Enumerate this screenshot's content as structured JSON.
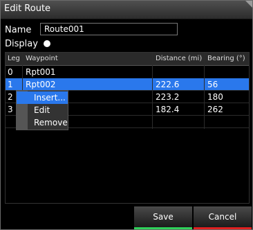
{
  "dialog": {
    "title": "Edit Route"
  },
  "form": {
    "name_label": "Name",
    "name_value": "Route001",
    "display_label": "Display"
  },
  "table": {
    "headers": [
      "Leg",
      "Waypoint",
      "Distance (mi)",
      "Bearing (°)"
    ],
    "rows": [
      {
        "leg": "0",
        "waypoint": "Rpt001",
        "distance": "",
        "bearing": ""
      },
      {
        "leg": "1",
        "waypoint": "Rpt002",
        "distance": "222.6",
        "bearing": "56",
        "selected": true
      },
      {
        "leg": "2",
        "waypoint": "",
        "distance": "223.2",
        "bearing": "180"
      },
      {
        "leg": "3",
        "waypoint": "",
        "distance": "182.4",
        "bearing": "262"
      }
    ]
  },
  "context_menu": {
    "items": [
      "Insert...",
      "Edit",
      "Remove"
    ],
    "highlighted": "Insert..."
  },
  "buttons": {
    "save": "Save",
    "cancel": "Cancel"
  },
  "colors": {
    "selection": "#2a78ec",
    "save_accent": "#2fd15a",
    "cancel_accent": "#e02020"
  }
}
